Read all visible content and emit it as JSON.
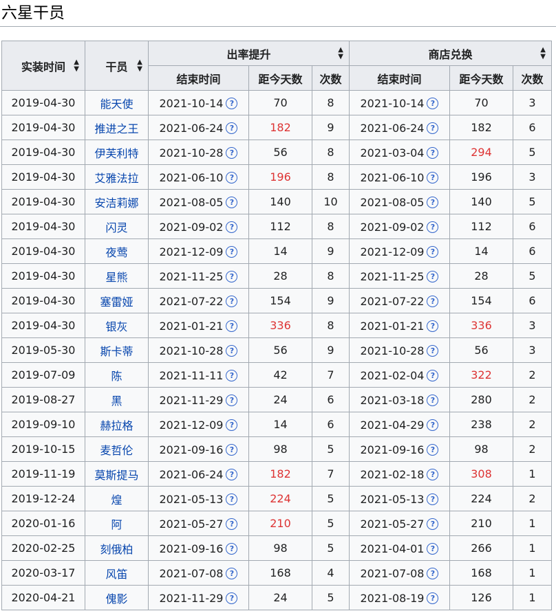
{
  "title": "六星干员",
  "header": {
    "install_time": "实装时间",
    "operator": "干员",
    "rate_up": "出率提升",
    "shop": "商店兑换",
    "end_time": "结束时间",
    "days_since": "距今天数",
    "count": "次数"
  },
  "colors": {
    "link": "#0645ad",
    "highlight": "#dd3333",
    "header_bg": "#eaecf0",
    "cell_bg": "#f8f9fa",
    "border": "#a2a9b1"
  },
  "icons": {
    "sort": "sort-icon",
    "help": "question-circle-icon"
  },
  "rows": [
    {
      "date": "2019-04-30",
      "name": "能天使",
      "r_end": "2021-10-14",
      "r_days": "70",
      "r_red": false,
      "r_cnt": "8",
      "s_end": "2021-10-14",
      "s_days": "70",
      "s_red": false,
      "s_cnt": "3"
    },
    {
      "date": "2019-04-30",
      "name": "推进之王",
      "r_end": "2021-06-24",
      "r_days": "182",
      "r_red": true,
      "r_cnt": "9",
      "s_end": "2021-06-24",
      "s_days": "182",
      "s_red": false,
      "s_cnt": "6"
    },
    {
      "date": "2019-04-30",
      "name": "伊芙利特",
      "r_end": "2021-10-28",
      "r_days": "56",
      "r_red": false,
      "r_cnt": "8",
      "s_end": "2021-03-04",
      "s_days": "294",
      "s_red": true,
      "s_cnt": "5"
    },
    {
      "date": "2019-04-30",
      "name": "艾雅法拉",
      "r_end": "2021-06-10",
      "r_days": "196",
      "r_red": true,
      "r_cnt": "8",
      "s_end": "2021-06-10",
      "s_days": "196",
      "s_red": false,
      "s_cnt": "3"
    },
    {
      "date": "2019-04-30",
      "name": "安洁莉娜",
      "r_end": "2021-08-05",
      "r_days": "140",
      "r_red": false,
      "r_cnt": "10",
      "s_end": "2021-08-05",
      "s_days": "140",
      "s_red": false,
      "s_cnt": "5"
    },
    {
      "date": "2019-04-30",
      "name": "闪灵",
      "r_end": "2021-09-02",
      "r_days": "112",
      "r_red": false,
      "r_cnt": "8",
      "s_end": "2021-09-02",
      "s_days": "112",
      "s_red": false,
      "s_cnt": "6"
    },
    {
      "date": "2019-04-30",
      "name": "夜莺",
      "r_end": "2021-12-09",
      "r_days": "14",
      "r_red": false,
      "r_cnt": "9",
      "s_end": "2021-12-09",
      "s_days": "14",
      "s_red": false,
      "s_cnt": "6"
    },
    {
      "date": "2019-04-30",
      "name": "星熊",
      "r_end": "2021-11-25",
      "r_days": "28",
      "r_red": false,
      "r_cnt": "8",
      "s_end": "2021-11-25",
      "s_days": "28",
      "s_red": false,
      "s_cnt": "5"
    },
    {
      "date": "2019-04-30",
      "name": "塞雷娅",
      "r_end": "2021-07-22",
      "r_days": "154",
      "r_red": false,
      "r_cnt": "9",
      "s_end": "2021-07-22",
      "s_days": "154",
      "s_red": false,
      "s_cnt": "6"
    },
    {
      "date": "2019-04-30",
      "name": "银灰",
      "r_end": "2021-01-21",
      "r_days": "336",
      "r_red": true,
      "r_cnt": "8",
      "s_end": "2021-01-21",
      "s_days": "336",
      "s_red": true,
      "s_cnt": "3"
    },
    {
      "date": "2019-05-30",
      "name": "斯卡蒂",
      "r_end": "2021-10-28",
      "r_days": "56",
      "r_red": false,
      "r_cnt": "9",
      "s_end": "2021-10-28",
      "s_days": "56",
      "s_red": false,
      "s_cnt": "3"
    },
    {
      "date": "2019-07-09",
      "name": "陈",
      "r_end": "2021-11-11",
      "r_days": "42",
      "r_red": false,
      "r_cnt": "7",
      "s_end": "2021-02-04",
      "s_days": "322",
      "s_red": true,
      "s_cnt": "2"
    },
    {
      "date": "2019-08-27",
      "name": "黑",
      "r_end": "2021-11-29",
      "r_days": "24",
      "r_red": false,
      "r_cnt": "6",
      "s_end": "2021-03-18",
      "s_days": "280",
      "s_red": false,
      "s_cnt": "2"
    },
    {
      "date": "2019-09-10",
      "name": "赫拉格",
      "r_end": "2021-12-09",
      "r_days": "14",
      "r_red": false,
      "r_cnt": "6",
      "s_end": "2021-04-29",
      "s_days": "238",
      "s_red": false,
      "s_cnt": "2"
    },
    {
      "date": "2019-10-15",
      "name": "麦哲伦",
      "r_end": "2021-09-16",
      "r_days": "98",
      "r_red": false,
      "r_cnt": "5",
      "s_end": "2021-09-16",
      "s_days": "98",
      "s_red": false,
      "s_cnt": "2"
    },
    {
      "date": "2019-11-19",
      "name": "莫斯提马",
      "r_end": "2021-06-24",
      "r_days": "182",
      "r_red": true,
      "r_cnt": "7",
      "s_end": "2021-02-18",
      "s_days": "308",
      "s_red": true,
      "s_cnt": "1"
    },
    {
      "date": "2019-12-24",
      "name": "煌",
      "r_end": "2021-05-13",
      "r_days": "224",
      "r_red": true,
      "r_cnt": "5",
      "s_end": "2021-05-13",
      "s_days": "224",
      "s_red": false,
      "s_cnt": "2"
    },
    {
      "date": "2020-01-16",
      "name": "阿",
      "r_end": "2021-05-27",
      "r_days": "210",
      "r_red": true,
      "r_cnt": "5",
      "s_end": "2021-05-27",
      "s_days": "210",
      "s_red": false,
      "s_cnt": "1"
    },
    {
      "date": "2020-02-25",
      "name": "刻俄柏",
      "r_end": "2021-09-16",
      "r_days": "98",
      "r_red": false,
      "r_cnt": "5",
      "s_end": "2021-04-01",
      "s_days": "266",
      "s_red": false,
      "s_cnt": "1"
    },
    {
      "date": "2020-03-17",
      "name": "风笛",
      "r_end": "2021-07-08",
      "r_days": "168",
      "r_red": false,
      "r_cnt": "4",
      "s_end": "2021-07-08",
      "s_days": "168",
      "s_red": false,
      "s_cnt": "1"
    },
    {
      "date": "2020-04-21",
      "name": "傀影",
      "r_end": "2021-11-29",
      "r_days": "24",
      "r_red": false,
      "r_cnt": "5",
      "s_end": "2021-08-19",
      "s_days": "126",
      "s_red": false,
      "s_cnt": "1"
    }
  ]
}
